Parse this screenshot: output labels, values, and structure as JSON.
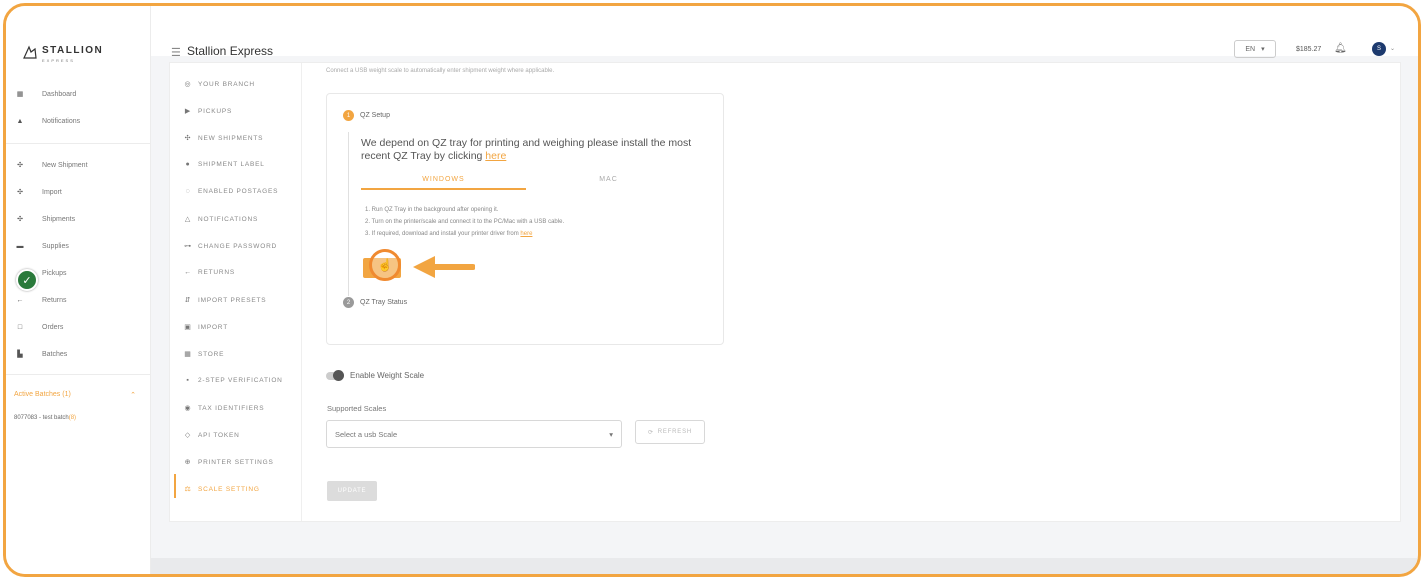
{
  "brand": {
    "name": "STALLION",
    "sub": "EXPRESS"
  },
  "header": {
    "title": "Stallion Express",
    "language": "EN",
    "balance": "$185.27",
    "avatar_initial": "S"
  },
  "sidebar": {
    "items": [
      {
        "label": "Dashboard",
        "icon": "dashboard-icon",
        "glyph": "▦"
      },
      {
        "label": "Notifications",
        "icon": "bell-icon",
        "glyph": "▲"
      },
      {
        "label": "New Shipment",
        "icon": "new-shipment-icon",
        "glyph": "✣"
      },
      {
        "label": "Import",
        "icon": "import-icon",
        "glyph": "✣"
      },
      {
        "label": "Shipments",
        "icon": "shipments-icon",
        "glyph": "✣"
      },
      {
        "label": "Supplies",
        "icon": "supplies-icon",
        "glyph": "▬"
      },
      {
        "label": "Pickups",
        "icon": "pickups-icon",
        "glyph": "▪"
      },
      {
        "label": "Returns",
        "icon": "returns-icon",
        "glyph": "←"
      },
      {
        "label": "Orders",
        "icon": "orders-icon",
        "glyph": "□"
      },
      {
        "label": "Batches",
        "icon": "batches-icon",
        "glyph": "▙"
      }
    ],
    "active_batches": "Active Batches (1)",
    "batch_entry": "8077083 - test batch",
    "batch_count": "(8)"
  },
  "settings_nav": {
    "items": [
      {
        "label": "YOUR BRANCH",
        "glyph": "◎"
      },
      {
        "label": "PICKUPS",
        "glyph": "▶"
      },
      {
        "label": "NEW SHIPMENTS",
        "glyph": "✣"
      },
      {
        "label": "SHIPMENT LABEL",
        "glyph": "●"
      },
      {
        "label": "ENABLED POSTAGES",
        "glyph": "◌"
      },
      {
        "label": "NOTIFICATIONS",
        "glyph": "△"
      },
      {
        "label": "CHANGE PASSWORD",
        "glyph": "⊶"
      },
      {
        "label": "RETURNS",
        "glyph": "←"
      },
      {
        "label": "IMPORT PRESETS",
        "glyph": "⇵"
      },
      {
        "label": "IMPORT",
        "glyph": "▣"
      },
      {
        "label": "STORE",
        "glyph": "▦"
      },
      {
        "label": "2-STEP VERIFICATION",
        "glyph": "▪"
      },
      {
        "label": "TAX IDENTIFIERS",
        "glyph": "◉"
      },
      {
        "label": "API TOKEN",
        "glyph": "◇"
      },
      {
        "label": "PRINTER SETTINGS",
        "glyph": "⊕"
      },
      {
        "label": "SCALE SETTING",
        "glyph": "⚖"
      }
    ]
  },
  "main": {
    "intro": "Connect a USB weight scale to automatically enter shipment weight where applicable.",
    "step1": {
      "num": "1",
      "label": "QZ Setup"
    },
    "step2": {
      "num": "2",
      "label": "QZ Tray Status"
    },
    "qz_desc_1": "We depend on QZ tray for printing and weighing please install the most recent QZ Tray by clicking ",
    "qz_link": "here",
    "tabs": [
      "WINDOWS",
      "MAC"
    ],
    "instructions": [
      "1. Run QZ Tray in the background after opening it.",
      "2. Turn on the printer/scale and connect it to the PC/Mac with a USB cable.",
      "3. If required, download and install your printer driver from "
    ],
    "driver_link": "here",
    "toggle_label": "Enable Weight Scale",
    "scales_label": "Supported Scales",
    "scale_placeholder": "Select a usb Scale",
    "refresh_label": "REFRESH",
    "update_label": "UPDATE"
  },
  "colors": {
    "accent": "#f2a541",
    "frame": "#f2a541",
    "success": "#2a7a3b"
  }
}
